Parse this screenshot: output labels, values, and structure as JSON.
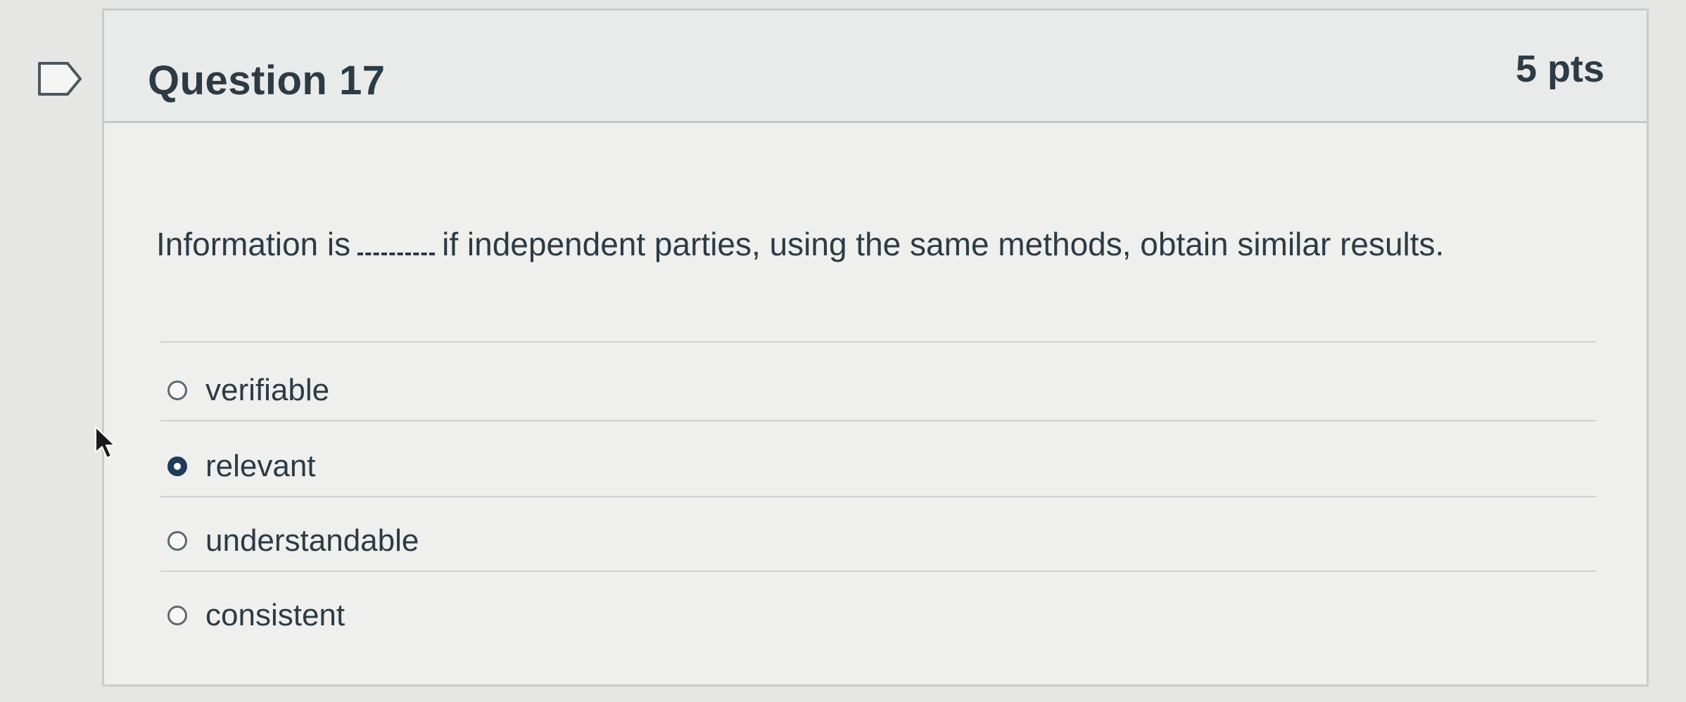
{
  "question": {
    "title": "Question 17",
    "points": "5 pts",
    "text_before": "Information is",
    "text_after": "if independent parties, using the same methods, obtain similar results."
  },
  "answers": [
    {
      "label": "verifiable",
      "selected": false
    },
    {
      "label": "relevant",
      "selected": true
    },
    {
      "label": "understandable",
      "selected": false
    },
    {
      "label": "consistent",
      "selected": false
    }
  ],
  "icons": {
    "flag": "flag-question-icon",
    "cursor": "mouse-pointer-icon"
  },
  "colors": {
    "text": "#2d3b45",
    "selected_radio": "#1f3b5a",
    "border": "#c9ccce"
  }
}
